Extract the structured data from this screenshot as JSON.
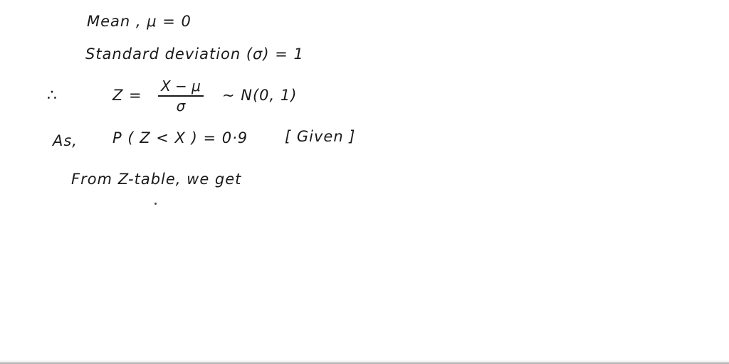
{
  "solution": {
    "mean_line": "Mean , μ = 0",
    "sd_line": "Standard deviation (σ) = 1",
    "therefore_symbol": "∴",
    "z_lhs": "Z =",
    "fraction_numerator": "X − μ",
    "fraction_denominator": "σ",
    "distribution": "~  N(0, 1)",
    "as_label": "As,",
    "probability": "P ( Z < X ) = 0·9",
    "given_note": "[ Given ]",
    "z_table_line": "From Z-table,  we get"
  }
}
